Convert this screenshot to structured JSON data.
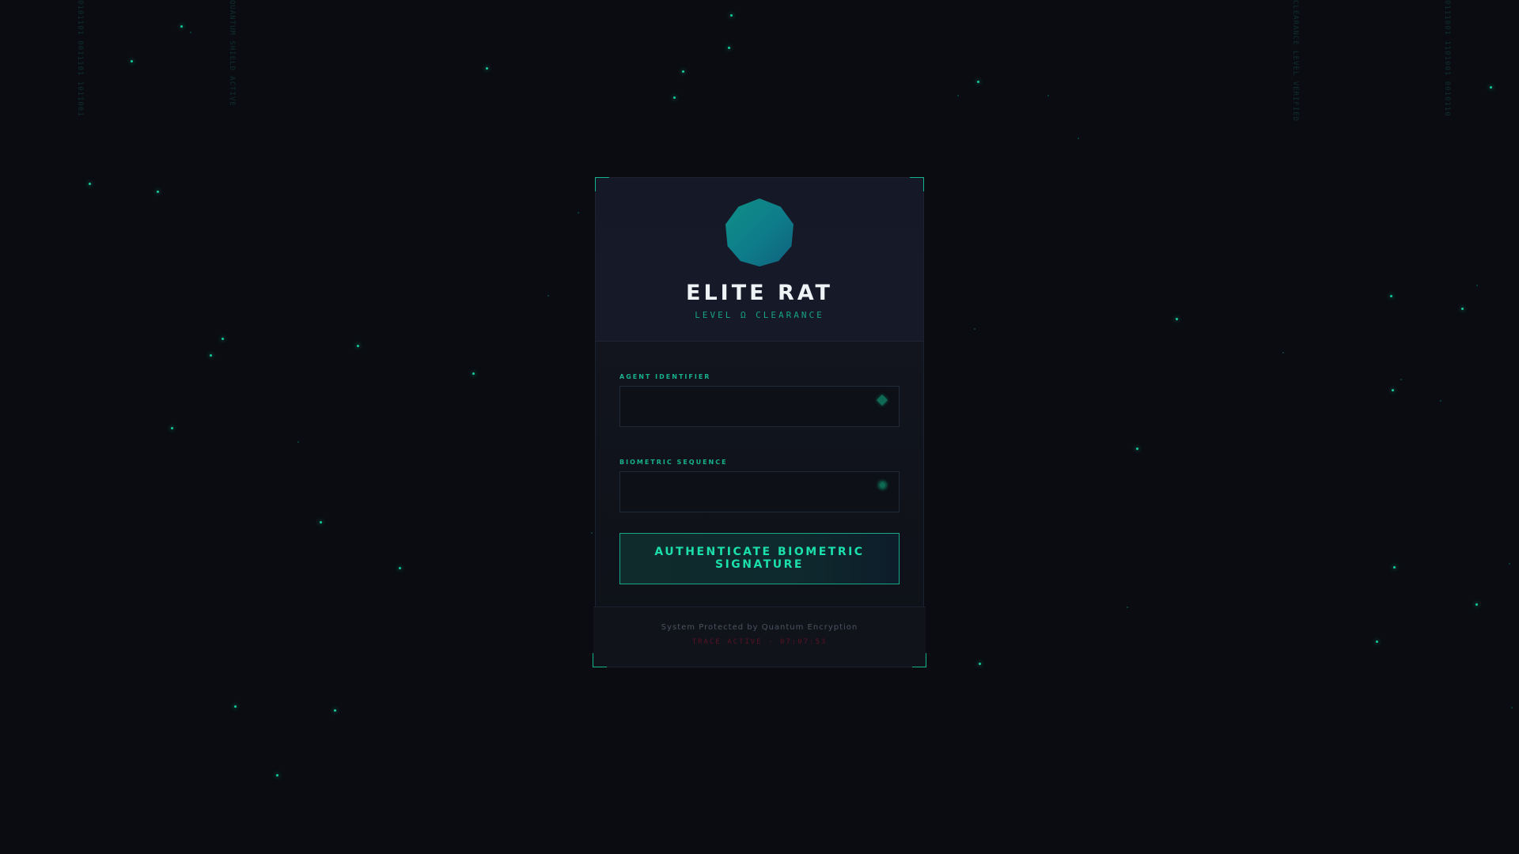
{
  "colors": {
    "background": "#0a0c11",
    "accent": "#17b08d",
    "button_text": "#1bdfac",
    "warning": "#5a1224"
  },
  "header": {
    "title": "ELITE RAT",
    "subtitle": "LEVEL Ω CLEARANCE",
    "logo_icon": "octagon-logo-icon"
  },
  "form": {
    "agent_identifier": {
      "label": "AGENT IDENTIFIER",
      "value": "",
      "placeholder": "",
      "icon": "diamond-icon"
    },
    "biometric_sequence": {
      "label": "BIOMETRIC SEQUENCE",
      "value": "",
      "placeholder": "",
      "icon": "dot-icon"
    },
    "submit_label": "AUTHENTICATE BIOMETRIC SIGNATURE"
  },
  "footer": {
    "note": "System Protected by Quantum Encryption",
    "trace": "TRACE ACTIVE · 07:07:53"
  }
}
